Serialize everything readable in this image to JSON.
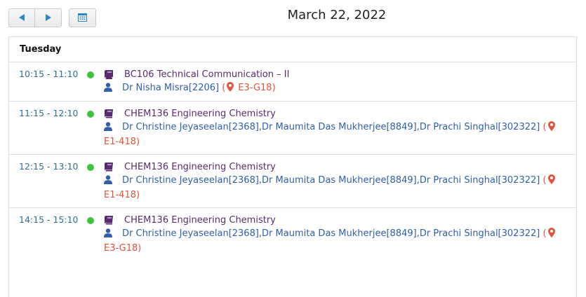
{
  "toolbar": {
    "prev_icon": "arrow-left-icon",
    "next_icon": "arrow-right-icon",
    "calendar_icon": "calendar-icon"
  },
  "date_title": "March 22, 2022",
  "day_label": "Tuesday",
  "colors": {
    "time": "#2e6f92",
    "course": "#5a2a6e",
    "faculty": "#2e5fa8",
    "venue": "#e0533e",
    "status_dot": "#3fc33f"
  },
  "sessions": [
    {
      "time": "10:15 - 11:10",
      "course": "BC106 Technical Communication – II",
      "faculty": "Dr Nisha Misra[2206]",
      "venue_open": " (",
      "venue": "E3-G18",
      "venue_close": ")"
    },
    {
      "time": "11:15 - 12:10",
      "course": "CHEM136 Engineering Chemistry",
      "faculty": "Dr Christine Jeyaseelan[2368],Dr Maumita Das Mukherjee[8849],Dr Prachi Singhal[302322]",
      "venue_open": " (",
      "venue": "E1-418",
      "venue_close": ")"
    },
    {
      "time": "12:15 - 13:10",
      "course": "CHEM136 Engineering Chemistry",
      "faculty": "Dr Christine Jeyaseelan[2368],Dr Maumita Das Mukherjee[8849],Dr Prachi Singhal[302322]",
      "venue_open": " (",
      "venue": "E1-418",
      "venue_close": ")"
    },
    {
      "time": "14:15 - 15:10",
      "course": "CHEM136 Engineering Chemistry",
      "faculty": "Dr Christine Jeyaseelan[2368],Dr Maumita Das Mukherjee[8849],Dr Prachi Singhal[302322]",
      "venue_open": " (",
      "venue": "E3-G18",
      "venue_close": ")"
    }
  ]
}
